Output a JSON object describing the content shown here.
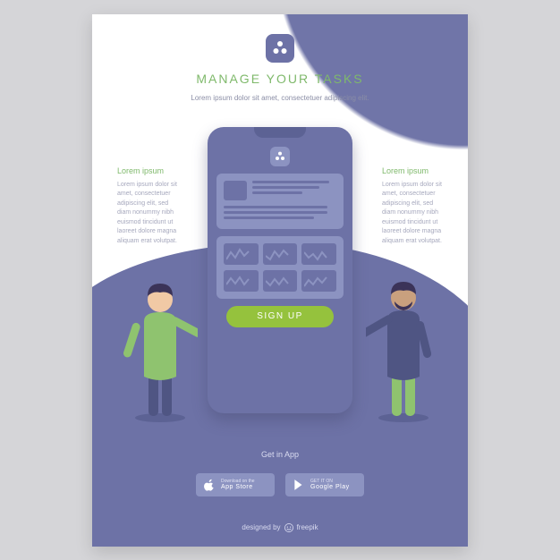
{
  "logo_icon": "three-dots-logo",
  "title": "MANAGE YOUR TASKS",
  "subtitle": "Lorem ipsum dolor sit amet, consectetuer adipiscing elit.",
  "side_left": {
    "title": "Lorem ipsum",
    "text": "Lorem ipsum dolor sit amet, consectetuer adipiscing elit, sed diam nonummy nibh euismod tincidunt ut laoreet dolore magna aliquam erat volutpat."
  },
  "side_right": {
    "title": "Lorem ipsum",
    "text": "Lorem ipsum dolor sit amet, consectetuer adipiscing elit, sed diam nonummy nibh euismod tincidunt ut laoreet dolore magna aliquam erat volutpat."
  },
  "signup_label": "SIGN UP",
  "get_in_app": "Get in App",
  "app_store": {
    "small": "Download on the",
    "big": "App Store"
  },
  "google_play": {
    "small": "GET IT ON",
    "big": "Google Play"
  },
  "attribution": "designed by",
  "attribution_brand": "freepik"
}
